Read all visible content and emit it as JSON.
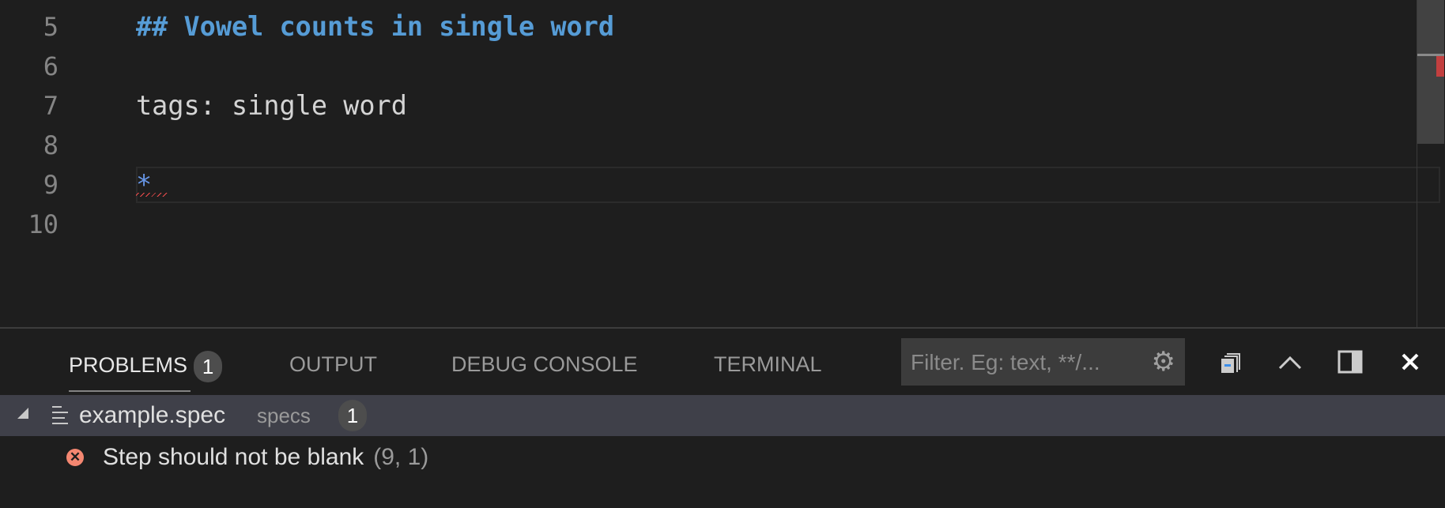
{
  "editor": {
    "lines": [
      {
        "number": "5",
        "text": "## Vowel counts in single word"
      },
      {
        "number": "6",
        "text": ""
      },
      {
        "number": "7",
        "text": "tags: single word"
      },
      {
        "number": "8",
        "text": ""
      },
      {
        "number": "9",
        "text": "*"
      },
      {
        "number": "10",
        "text": ""
      }
    ]
  },
  "panel": {
    "tabs": [
      {
        "label": "PROBLEMS",
        "badge": "1"
      },
      {
        "label": "OUTPUT"
      },
      {
        "label": "DEBUG CONSOLE"
      },
      {
        "label": "TERMINAL"
      }
    ],
    "filter_placeholder": "Filter. Eg: text, **/...",
    "problems": {
      "file": {
        "name": "example.spec",
        "folder": "specs",
        "count": "1"
      },
      "items": [
        {
          "message": "Step should not be blank",
          "position": "(9, 1)",
          "severity": "error"
        }
      ]
    }
  },
  "colors": {
    "heading": "#569cd6",
    "error": "#f48771",
    "accent_bg": "#3f4049"
  }
}
